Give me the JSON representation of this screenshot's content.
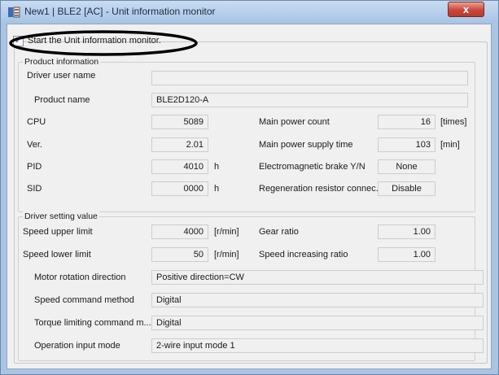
{
  "window": {
    "title": "New1 | BLE2 [AC] - Unit information monitor",
    "close_glyph": "x"
  },
  "monitor": {
    "checkbox_checked": true,
    "label": "Start the Unit information monitor."
  },
  "product_info": {
    "title": "Product information",
    "driver_user_name": {
      "label": "Driver user name",
      "value": ""
    },
    "product_name": {
      "label": "Product name",
      "value": "BLE2D120-A"
    },
    "cpu": {
      "label": "CPU",
      "value": "5089"
    },
    "ver": {
      "label": "Ver.",
      "value": "2.01"
    },
    "pid": {
      "label": "PID",
      "value": "4010",
      "unit": "h"
    },
    "sid": {
      "label": "SID",
      "value": "0000",
      "unit": "h"
    },
    "main_power_count": {
      "label": "Main power count",
      "value": "16",
      "unit": "[times]"
    },
    "main_power_supply_time": {
      "label": "Main power supply time",
      "value": "103",
      "unit": "[min]"
    },
    "brake": {
      "label": "Electromagnetic brake Y/N",
      "value": "None"
    },
    "regen": {
      "label": "Regeneration resistor connec...",
      "value": "Disable"
    }
  },
  "driver_setting": {
    "title": "Driver setting value",
    "speed_upper_limit": {
      "label": "Speed upper limit",
      "value": "4000",
      "unit": "[r/min]"
    },
    "speed_lower_limit": {
      "label": "Speed lower limit",
      "value": "50",
      "unit": "[r/min]"
    },
    "gear_ratio": {
      "label": "Gear ratio",
      "value": "1.00"
    },
    "speed_increasing_ratio": {
      "label": "Speed increasing ratio",
      "value": "1.00"
    },
    "motor_rotation_direction": {
      "label": "Motor rotation direction",
      "value": "Positive direction=CW"
    },
    "speed_command_method": {
      "label": "Speed command method",
      "value": "Digital"
    },
    "torque_limiting": {
      "label": "Torque limiting command m...",
      "value": "Digital"
    },
    "operation_input_mode": {
      "label": "Operation input mode",
      "value": "2-wire input mode 1"
    }
  },
  "colors": {
    "frame": "#aac4e2",
    "panel": "#f0f0f0",
    "close_button": "#c7473a",
    "annotation": "#000000"
  },
  "icons": [
    "app-icon",
    "close-icon",
    "check-icon"
  ]
}
